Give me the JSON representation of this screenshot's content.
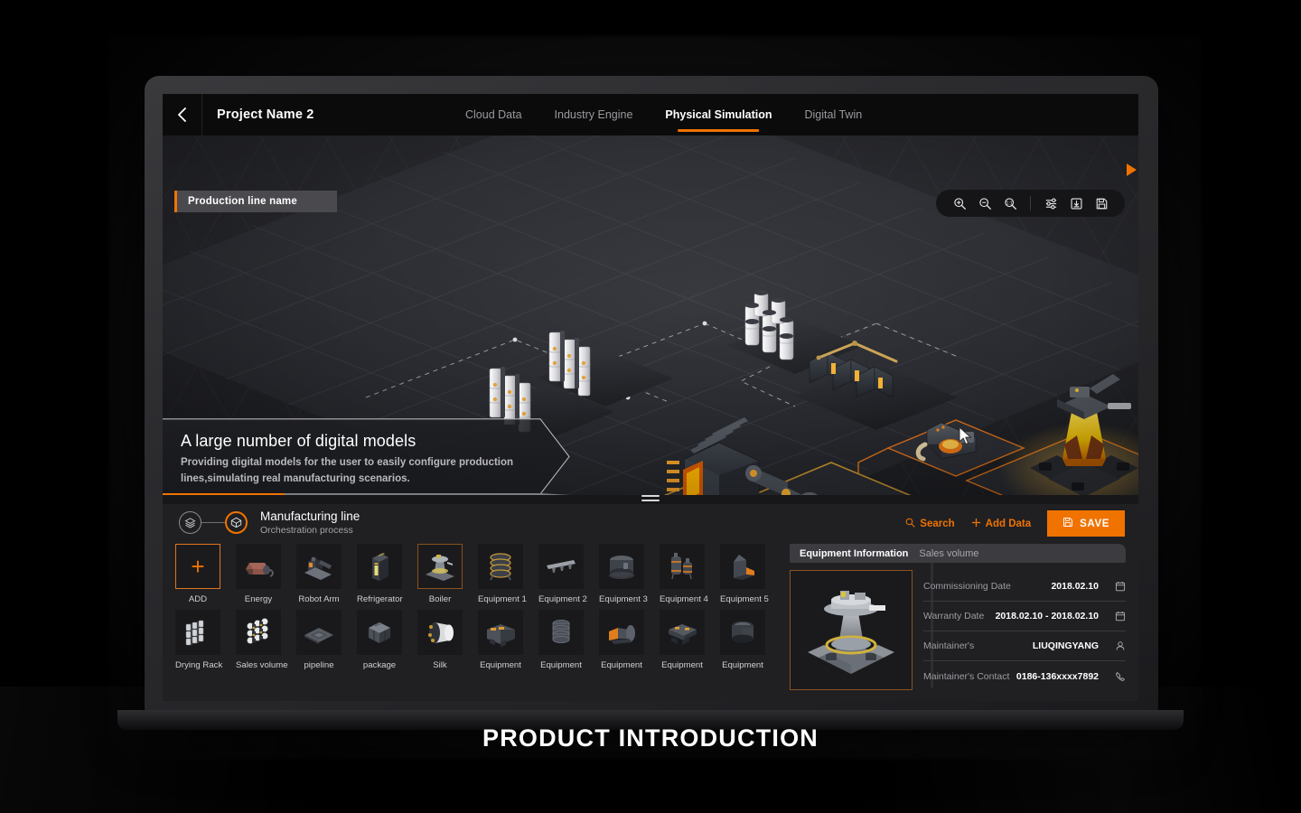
{
  "promo": {
    "caption": "PRODUCT INTRODUCTION"
  },
  "topbar": {
    "back_icon": "chevron-left-icon",
    "project_title": "Project Name 2",
    "tabs": [
      {
        "label": "Cloud Data",
        "active": false
      },
      {
        "label": "Industry Engine",
        "active": false
      },
      {
        "label": "Physical Simulation",
        "active": true
      },
      {
        "label": "Digital Twin",
        "active": false
      }
    ]
  },
  "viewport": {
    "production_line_label": "Production line name",
    "tools": [
      {
        "name": "zoom-in-icon"
      },
      {
        "name": "zoom-out-icon"
      },
      {
        "name": "zoom-reset-icon"
      },
      {
        "name": "settings-sliders-icon"
      },
      {
        "name": "download-icon"
      },
      {
        "name": "save-icon"
      }
    ],
    "caption": {
      "title": "A large number of digital models",
      "subtitle": "Providing digital models for the user to easily configure production lines,simulating real manufacturing scenarios.",
      "next_arrow": "play-arrow-icon"
    }
  },
  "bottom": {
    "step1_icon": "layers-icon",
    "step2_icon": "cube-icon",
    "title": "Manufacturing line",
    "subtitle": "Orchestration process",
    "search_label": "Search",
    "add_data_label": "Add Data",
    "save_label": "SAVE",
    "palette": {
      "row1": [
        {
          "label": "ADD",
          "state": "add"
        },
        {
          "label": "Energy",
          "state": "normal"
        },
        {
          "label": "Robot Arm",
          "state": "normal"
        },
        {
          "label": "Refrigerator",
          "state": "normal"
        },
        {
          "label": "Boiler",
          "state": "selected"
        },
        {
          "label": "Equipment 1",
          "state": "normal"
        },
        {
          "label": "Equipment 2",
          "state": "normal"
        },
        {
          "label": "Equipment 3",
          "state": "normal"
        },
        {
          "label": "Equipment 4",
          "state": "normal"
        },
        {
          "label": "Equipment 5",
          "state": "normal"
        }
      ],
      "row2": [
        {
          "label": "Drying Rack",
          "state": "normal"
        },
        {
          "label": "Sales volume",
          "state": "normal"
        },
        {
          "label": "pipeline",
          "state": "normal"
        },
        {
          "label": "package",
          "state": "normal"
        },
        {
          "label": "Silk",
          "state": "normal"
        },
        {
          "label": "Equipment",
          "state": "normal"
        },
        {
          "label": "Equipment",
          "state": "normal"
        },
        {
          "label": "Equipment",
          "state": "normal"
        },
        {
          "label": "Equipment",
          "state": "normal"
        },
        {
          "label": "Equipment",
          "state": "normal"
        }
      ]
    },
    "info": {
      "tabs": [
        {
          "label": "Equipment  Information",
          "active": true
        },
        {
          "label": "Sales volume",
          "active": false
        }
      ],
      "rows": [
        {
          "key": "Commissioning Date",
          "value": "2018.02.10",
          "icon": "calendar-icon"
        },
        {
          "key": "Warranty Date",
          "value": "2018.02.10 -  2018.02.10",
          "icon": "calendar-icon"
        },
        {
          "key": "Maintainer's",
          "value": "LIUQINGYANG",
          "icon": "person-icon"
        },
        {
          "key": "Maintainer's Contact",
          "value": "0186-136xxxx7892",
          "icon": "phone-icon"
        }
      ]
    }
  },
  "colors": {
    "accent": "#f07300",
    "panel_bg": "#202023",
    "screen_bg": "#1a1a1c",
    "topbar_bg": "#0b0b0c"
  }
}
